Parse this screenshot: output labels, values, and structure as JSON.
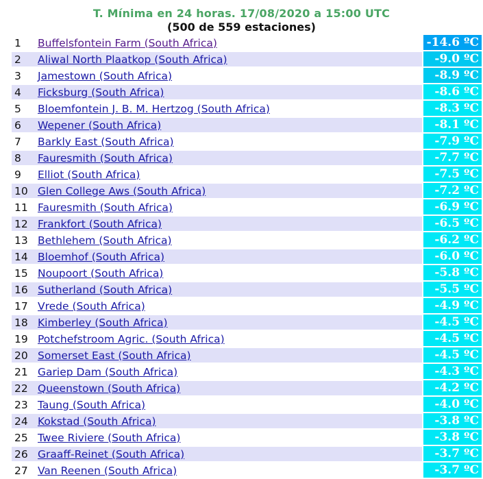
{
  "header": {
    "title": "T. Mínima en 24 horas. 17/08/2020 a 15:00 UTC",
    "subtitle": "(500 de 559 estaciones)"
  },
  "colors": {
    "title_green": "#4aa564",
    "row_stripe": "#e0e0f8",
    "link": "#1a1aa6",
    "link_visited": "#551a8b",
    "temp_bg_coldest": "#00a0f0",
    "temp_bg_cold": "#00d0f0",
    "temp_bg_cyan": "#00ecf8"
  },
  "rows": [
    {
      "rank": "1",
      "station": "Buffelsfontein Farm (South Africa)",
      "temp": "-14.6 ºC",
      "bg": "#00a2f2",
      "visited": true
    },
    {
      "rank": "2",
      "station": "Aliwal North Plaatkop (South Africa)",
      "temp": "-9.0 ºC",
      "bg": "#00c8f0",
      "visited": false
    },
    {
      "rank": "3",
      "station": "Jamestown (South Africa)",
      "temp": "-8.9 ºC",
      "bg": "#00caf0",
      "visited": false
    },
    {
      "rank": "4",
      "station": "Ficksburg (South Africa)",
      "temp": "-8.6 ºC",
      "bg": "#00e8f6",
      "visited": false
    },
    {
      "rank": "5",
      "station": "Bloemfontein J. B. M. Hertzog (South Africa)",
      "temp": "-8.3 ºC",
      "bg": "#00e8f6",
      "visited": false
    },
    {
      "rank": "6",
      "station": "Wepener (South Africa)",
      "temp": "-8.1 ºC",
      "bg": "#00e8f6",
      "visited": false
    },
    {
      "rank": "7",
      "station": "Barkly East (South Africa)",
      "temp": "-7.9 ºC",
      "bg": "#00e8f6",
      "visited": false
    },
    {
      "rank": "8",
      "station": "Fauresmith (South Africa)",
      "temp": "-7.7 ºC",
      "bg": "#00e8f6",
      "visited": false
    },
    {
      "rank": "9",
      "station": "Elliot (South Africa)",
      "temp": "-7.5 ºC",
      "bg": "#00e8f6",
      "visited": false
    },
    {
      "rank": "10",
      "station": "Glen College Aws (South Africa)",
      "temp": "-7.2 ºC",
      "bg": "#00e8f6",
      "visited": false
    },
    {
      "rank": "11",
      "station": "Fauresmith (South Africa)",
      "temp": "-6.9 ºC",
      "bg": "#00e8f6",
      "visited": false
    },
    {
      "rank": "12",
      "station": "Frankfort (South Africa)",
      "temp": "-6.5 ºC",
      "bg": "#00e8f6",
      "visited": false
    },
    {
      "rank": "13",
      "station": "Bethlehem (South Africa)",
      "temp": "-6.2 ºC",
      "bg": "#00e8f6",
      "visited": false
    },
    {
      "rank": "14",
      "station": "Bloemhof (South Africa)",
      "temp": "-6.0 ºC",
      "bg": "#00e8f6",
      "visited": false
    },
    {
      "rank": "15",
      "station": "Noupoort (South Africa)",
      "temp": "-5.8 ºC",
      "bg": "#00e8f6",
      "visited": false
    },
    {
      "rank": "16",
      "station": "Sutherland (South Africa)",
      "temp": "-5.5 ºC",
      "bg": "#00e8f6",
      "visited": false
    },
    {
      "rank": "17",
      "station": "Vrede (South Africa)",
      "temp": "-4.9 ºC",
      "bg": "#00e8f6",
      "visited": false
    },
    {
      "rank": "18",
      "station": "Kimberley (South Africa)",
      "temp": "-4.5 ºC",
      "bg": "#00e8f6",
      "visited": false
    },
    {
      "rank": "19",
      "station": "Potchefstroom Agric. (South Africa)",
      "temp": "-4.5 ºC",
      "bg": "#00e8f6",
      "visited": false
    },
    {
      "rank": "20",
      "station": "Somerset East (South Africa)",
      "temp": "-4.5 ºC",
      "bg": "#00e8f6",
      "visited": false
    },
    {
      "rank": "21",
      "station": "Gariep Dam (South Africa)",
      "temp": "-4.3 ºC",
      "bg": "#00e8f6",
      "visited": false
    },
    {
      "rank": "22",
      "station": "Queenstown (South Africa)",
      "temp": "-4.2 ºC",
      "bg": "#00e8f6",
      "visited": false
    },
    {
      "rank": "23",
      "station": "Taung (South Africa)",
      "temp": "-4.0 ºC",
      "bg": "#00e8f6",
      "visited": false
    },
    {
      "rank": "24",
      "station": "Kokstad (South Africa)",
      "temp": "-3.8 ºC",
      "bg": "#00e8f6",
      "visited": false
    },
    {
      "rank": "25",
      "station": "Twee Riviere (South Africa)",
      "temp": "-3.8 ºC",
      "bg": "#00e8f6",
      "visited": false
    },
    {
      "rank": "26",
      "station": "Graaff-Reinet (South Africa)",
      "temp": "-3.7 ºC",
      "bg": "#00e8f6",
      "visited": false
    },
    {
      "rank": "27",
      "station": "Van Reenen (South Africa)",
      "temp": "-3.7 ºC",
      "bg": "#00e8f6",
      "visited": false
    }
  ]
}
